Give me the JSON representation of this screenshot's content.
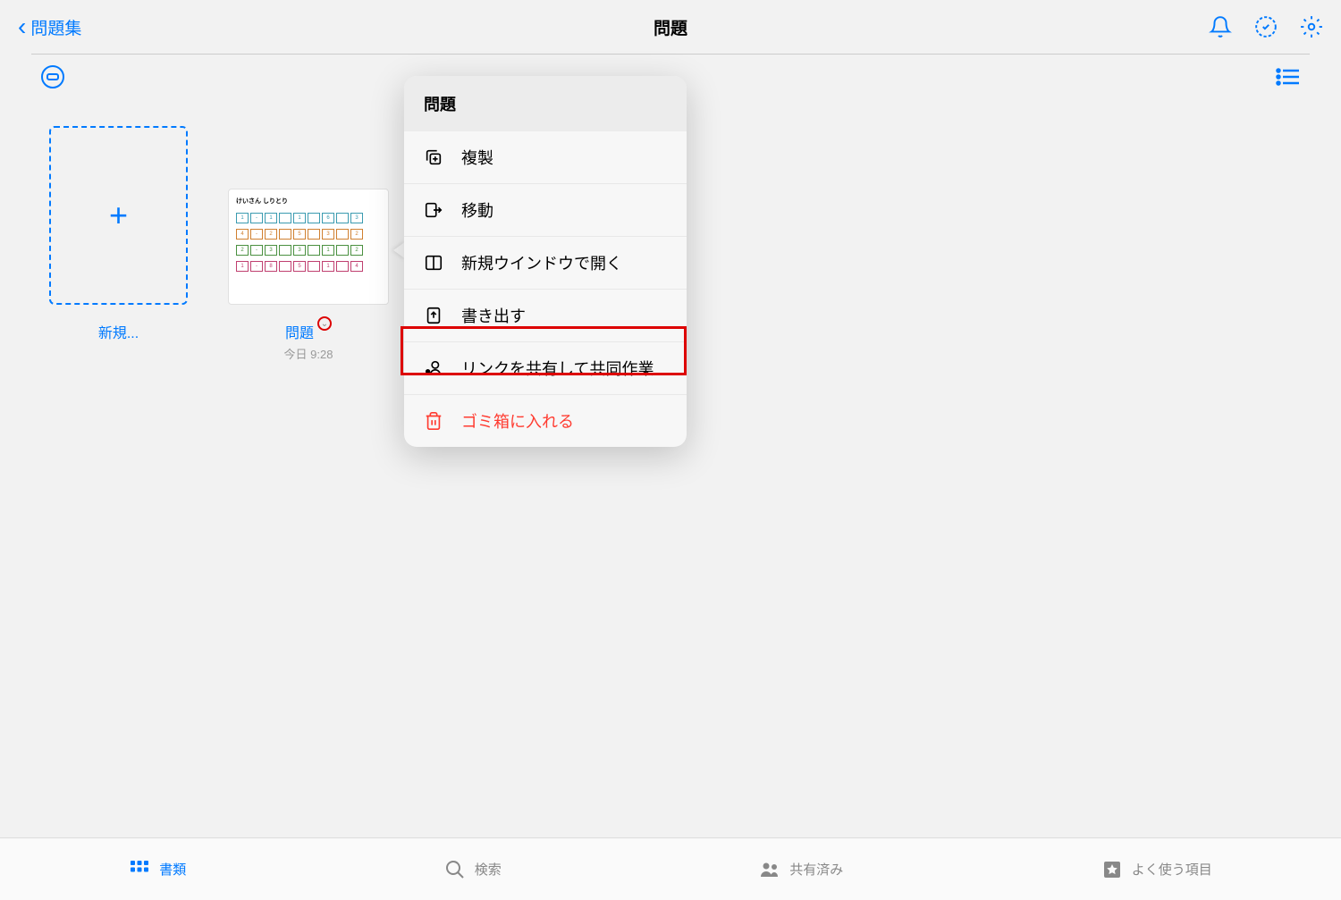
{
  "header": {
    "back_label": "問題集",
    "title": "問題"
  },
  "tiles": {
    "new_label": "新規...",
    "doc": {
      "name": "問題",
      "date": "今日 9:28",
      "thumb_title": "けいさん しりとり"
    }
  },
  "context_menu": {
    "title": "問題",
    "items": [
      {
        "icon": "duplicate",
        "label": "複製"
      },
      {
        "icon": "move",
        "label": "移動"
      },
      {
        "icon": "new-window",
        "label": "新規ウインドウで開く"
      },
      {
        "icon": "export",
        "label": "書き出す"
      },
      {
        "icon": "share",
        "label": "リンクを共有して共同作業",
        "highlighted": true
      },
      {
        "icon": "trash",
        "label": "ゴミ箱に入れる",
        "danger": true
      }
    ]
  },
  "tabs": [
    {
      "icon": "grid",
      "label": "書類",
      "active": true
    },
    {
      "icon": "search",
      "label": "検索"
    },
    {
      "icon": "people",
      "label": "共有済み"
    },
    {
      "icon": "star",
      "label": "よく使う項目"
    }
  ]
}
